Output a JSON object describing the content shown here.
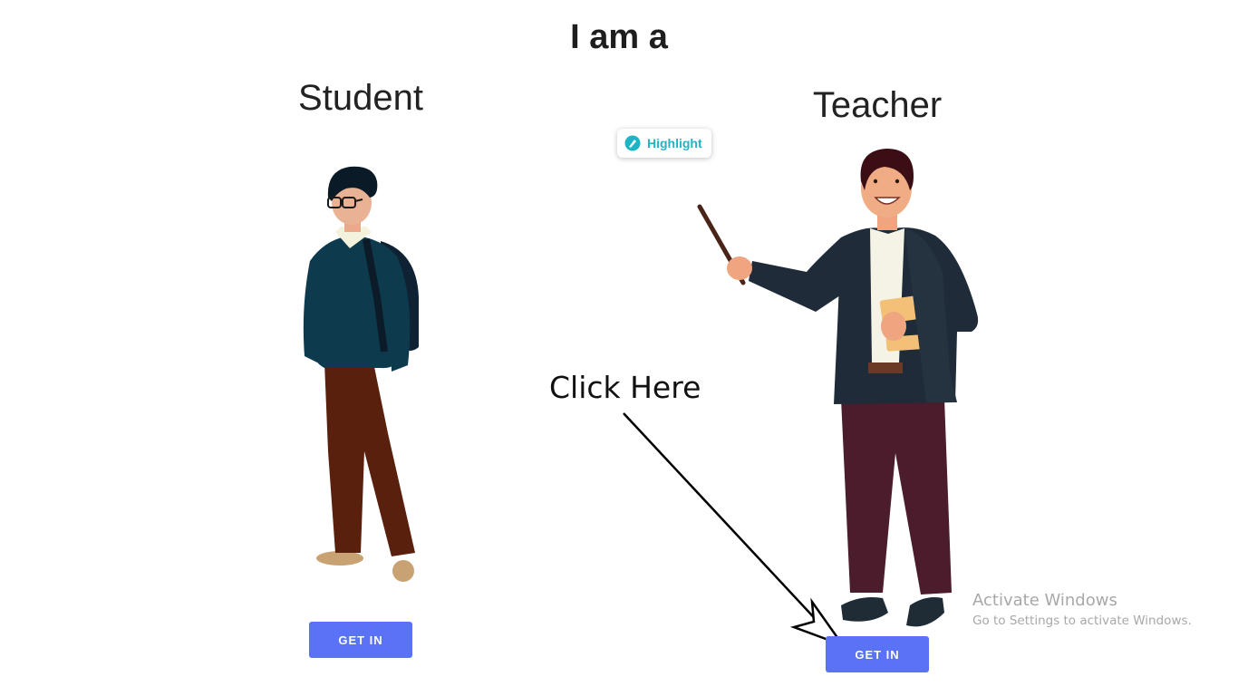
{
  "page": {
    "title": "I am a"
  },
  "roles": {
    "student": {
      "title": "Student",
      "button_label": "GET IN"
    },
    "teacher": {
      "title": "Teacher",
      "button_label": "GET IN"
    }
  },
  "annotation": {
    "text": "Click Here"
  },
  "highlight_chip": {
    "label": "Highlight",
    "icon": "highlight-icon"
  },
  "watermark": {
    "title": "Activate Windows",
    "subtitle": "Go to Settings to activate Windows."
  },
  "colors": {
    "button": "#5a72f5",
    "highlight_accent": "#1fb4c4",
    "title_text": "#1e1e1e"
  }
}
